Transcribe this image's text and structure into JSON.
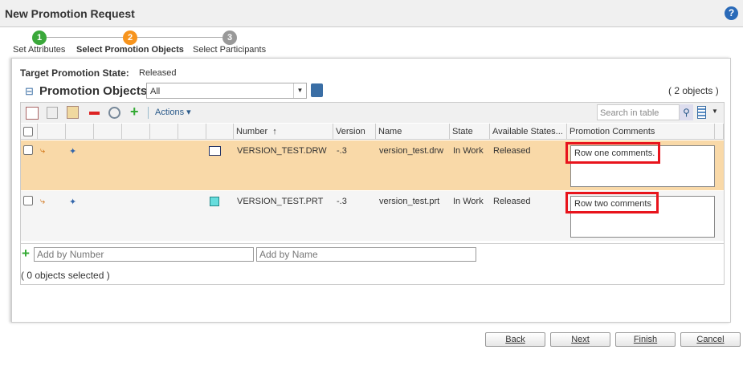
{
  "header": {
    "title": "New Promotion Request",
    "help_icon": "?"
  },
  "steps": [
    {
      "num": "1",
      "label": "Set Attributes",
      "color": "#3aa83a"
    },
    {
      "num": "2",
      "label": "Select Promotion Objects",
      "color": "#f7941d"
    },
    {
      "num": "3",
      "label": "Select Participants",
      "color": "#999999"
    }
  ],
  "target": {
    "label": "Target Promotion State:",
    "value": "Released"
  },
  "section": {
    "title": "Promotion Objects",
    "collapse": "⊟",
    "filter": "All",
    "count": "( 2 objects )"
  },
  "toolbar": {
    "actions": "Actions",
    "search_placeholder": "Search in table"
  },
  "columns": [
    "Number",
    "Version",
    "Name",
    "State",
    "Available States...",
    "Promotion Comments"
  ],
  "sort_indicator": "↑",
  "rows": [
    {
      "number": "VERSION_TEST.DRW",
      "version": "-.3",
      "name": "version_test.drw",
      "state": "In Work",
      "available": "Released",
      "comment": "Row one comments."
    },
    {
      "number": "VERSION_TEST.PRT",
      "version": "-.3",
      "name": "version_test.prt",
      "state": "In Work",
      "available": "Released",
      "comment": "Row two comments"
    }
  ],
  "add": {
    "by_number": "Add by Number",
    "by_name": "Add by Name"
  },
  "selected": "( 0 objects selected )",
  "buttons": {
    "back": "Back",
    "next": "Next",
    "finish": "Finish",
    "cancel": "Cancel"
  }
}
